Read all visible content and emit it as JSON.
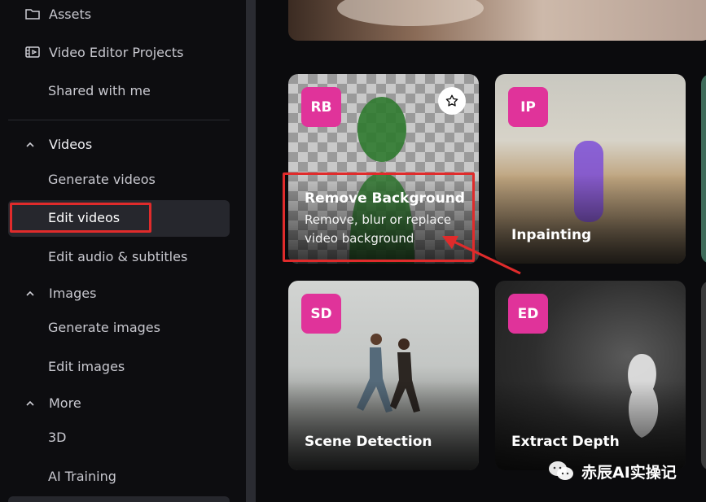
{
  "sidebar": {
    "top_items": [
      {
        "label": "Assets",
        "icon": "folder-icon"
      },
      {
        "label": "Video Editor Projects",
        "icon": "video-editor-icon"
      },
      {
        "label": "Shared with me"
      }
    ],
    "videos": {
      "title": "Videos",
      "items": [
        {
          "label": "Generate videos"
        },
        {
          "label": "Edit videos",
          "selected": true
        },
        {
          "label": "Edit audio & subtitles"
        }
      ]
    },
    "images": {
      "title": "Images",
      "items": [
        {
          "label": "Generate images"
        },
        {
          "label": "Edit images"
        }
      ]
    },
    "more": {
      "title": "More",
      "items": [
        {
          "label": "3D"
        },
        {
          "label": "AI Training"
        }
      ]
    }
  },
  "cards": [
    {
      "badge": "RB",
      "title": "Remove Background",
      "description": "Remove, blur or replace video background",
      "favorite_icon": "star-icon"
    },
    {
      "badge": "IP",
      "title": "Inpainting"
    },
    {
      "badge": "SD",
      "title": "Scene Detection"
    },
    {
      "badge": "ED",
      "title": "Extract Depth"
    }
  ],
  "watermark": {
    "text": "赤辰AI实操记",
    "icon": "wechat-icon"
  },
  "colors": {
    "badge": "#e0339a",
    "highlight": "#e02b2b",
    "sidebar_selected": "#26272d"
  }
}
